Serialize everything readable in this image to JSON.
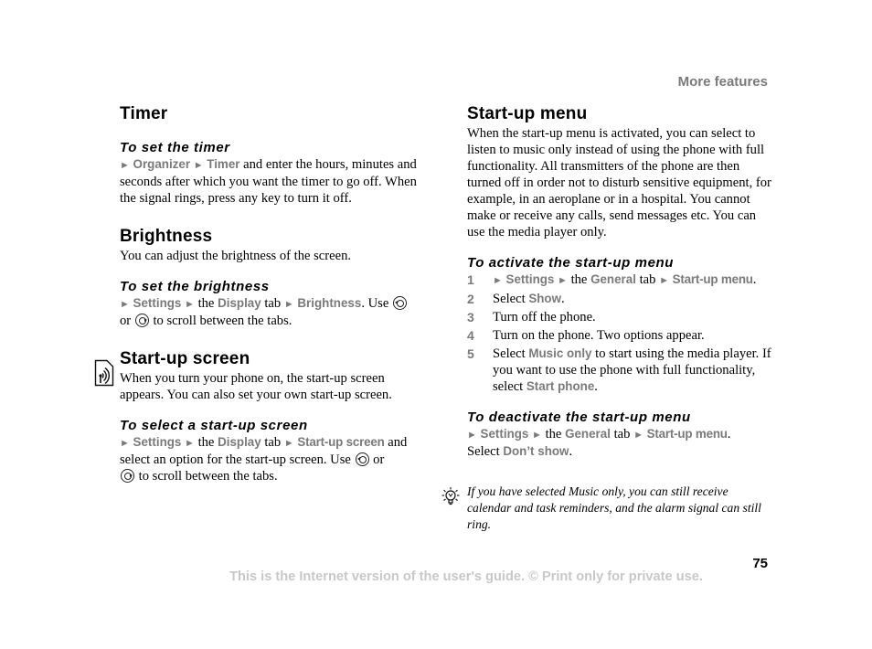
{
  "header": {
    "section_title": "More features"
  },
  "left_column": {
    "timer": {
      "heading": "Timer",
      "subheading": "To set the timer",
      "nav": [
        "Organizer",
        "Timer"
      ],
      "text": " and enter the hours, minutes and seconds after which you want the timer to go off. When the signal rings, press any key to turn it off."
    },
    "brightness": {
      "heading": "Brightness",
      "intro": "You can adjust the brightness of the screen.",
      "subheading": "To set the brightness",
      "nav1": "Settings",
      "the": " the ",
      "nav2": "Display",
      "tab": " tab ",
      "nav3": "Brightness",
      "use": ". Use ",
      "or": " or ",
      "scroll": " to scroll between the tabs."
    },
    "startup_screen": {
      "heading": "Start-up screen",
      "icon": "wireless-service-icon",
      "intro": "When you turn your phone on, the start-up screen appears. You can also set your own start-up screen.",
      "subheading": "To select a start-up screen",
      "nav1": "Settings",
      "the": " the ",
      "nav2": "Display",
      "tab": " tab ",
      "nav3": "Start-up screen",
      "rest": " and select an option for the start-up screen. Use ",
      "or": " or ",
      "scroll": " to scroll between the tabs."
    }
  },
  "right_column": {
    "startup_menu": {
      "heading": "Start-up menu",
      "intro": "When the start-up menu is activated, you can select to listen to music only instead of using the phone with full functionality. All transmitters of the phone are then turned off in order not to disturb sensitive equipment, for example, in an aeroplane or in a hospital. You cannot make or receive any calls, send messages etc. You can use the media player only.",
      "activate_heading": "To activate the start-up menu",
      "steps": [
        {
          "num": "1",
          "nav1": "Settings",
          "the": " the ",
          "nav2": "General",
          "tab": " tab ",
          "nav3": "Start-up menu",
          "end": "."
        },
        {
          "num": "2",
          "pre": "Select ",
          "ui": "Show",
          "end": "."
        },
        {
          "num": "3",
          "text": "Turn off the phone."
        },
        {
          "num": "4",
          "text": "Turn on the phone. Two options appear."
        },
        {
          "num": "5",
          "pre": "Select ",
          "ui": "Music only",
          "mid": " to start using the media player. If you want to use the phone with full functionality, select ",
          "ui2": "Start phone",
          "end": "."
        }
      ],
      "deactivate_heading": "To deactivate the start-up menu",
      "deactivate": {
        "nav1": "Settings",
        "the": " the ",
        "nav2": "General",
        "tab": " tab ",
        "nav3": "Start-up menu",
        "end": ".",
        "select_pre": "Select ",
        "select_ui": "Don’t show",
        "select_end": "."
      },
      "tip": "If you have selected Music only, you can still receive calendar and task reminders, and the alarm signal can still ring."
    }
  },
  "footer": {
    "page_number": "75",
    "notice": "This is the Internet version of the user's guide. © Print only for private use."
  },
  "symbols": {
    "arrow": "►"
  }
}
